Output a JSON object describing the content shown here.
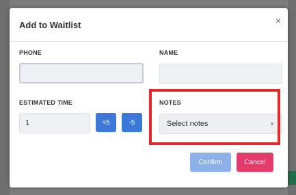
{
  "modal": {
    "title": "Add to Waitlist",
    "close_icon": "close-icon",
    "close_glyph": "×"
  },
  "form": {
    "phone": {
      "label": "PHONE",
      "value": ""
    },
    "name": {
      "label": "NAME",
      "value": ""
    },
    "estimated_time": {
      "label": "ESTIMATED TIME",
      "value": "1",
      "increment_label": "+5",
      "decrement_label": "-5"
    },
    "notes": {
      "label": "NOTES",
      "selected": "Select notes",
      "caret_glyph": "▼"
    }
  },
  "actions": {
    "confirm_label": "Confirm",
    "cancel_label": "Cancel"
  },
  "colors": {
    "primary": "#3b78d8",
    "confirm_disabled": "#8cb0e8",
    "cancel": "#e33b6a",
    "highlight": "#e02a2a"
  }
}
